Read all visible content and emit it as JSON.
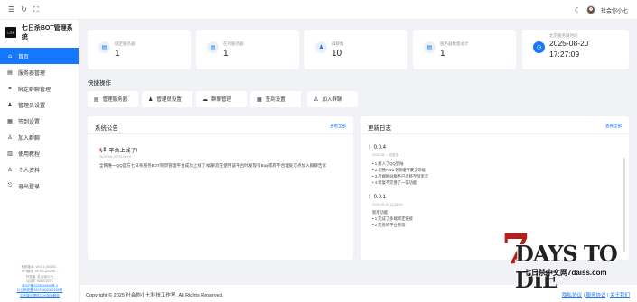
{
  "topbar": {
    "username": "社会你小七"
  },
  "brand": {
    "logo_text": "七日杀",
    "title": "七日杀BOT管理系统"
  },
  "menu": [
    {
      "label": "首页",
      "icon": "home-icon",
      "glyph": "⌂"
    },
    {
      "label": "服务器管理",
      "icon": "server-icon",
      "glyph": "▤"
    },
    {
      "label": "绑定群聊管理",
      "icon": "link-icon",
      "glyph": "⚭"
    },
    {
      "label": "管理员设置",
      "icon": "admin-icon",
      "glyph": "♟"
    },
    {
      "label": "签到设置",
      "icon": "calendar-icon",
      "glyph": "▦"
    },
    {
      "label": "加入群聊",
      "icon": "join-icon",
      "glyph": "♙"
    },
    {
      "label": "使用教程",
      "icon": "book-icon",
      "glyph": "▥"
    },
    {
      "label": "个人资料",
      "icon": "user-icon",
      "glyph": "♙"
    },
    {
      "label": "退出登录",
      "icon": "logout-icon",
      "glyph": "⎋"
    }
  ],
  "sidebar_footer": {
    "line1": "系统版本: v0.0.1 (20250...",
    "line2": "API版本: v0.0.4 (20250...",
    "line3": "开发者: 社会你小七",
    "line4": "QQ群: 925072073",
    "link1": "粤ICP备2025034906号-4",
    "link2": "川公网安备 51070402000159号",
    "link3": "由天翼云提供CDN加速服务"
  },
  "stats": [
    {
      "label": "绑定服务器",
      "value": "1",
      "icon": "server-icon",
      "glyph": "▤"
    },
    {
      "label": "在线服务器",
      "value": "1",
      "icon": "online-server-icon",
      "glyph": "▤"
    },
    {
      "label": "群聊数",
      "value": "10",
      "icon": "group-icon",
      "glyph": "♟"
    },
    {
      "label": "服务器数量总计",
      "value": "1",
      "icon": "server-total-icon",
      "glyph": "▤"
    }
  ],
  "time_card": {
    "label": "北京服务器时间",
    "date": "2025-08-20",
    "time": "17:27:09"
  },
  "quick": {
    "title": "快捷操作",
    "buttons": [
      {
        "label": "管理服务器",
        "glyph": "▤",
        "icon": "server-icon"
      },
      {
        "label": "管理员设置",
        "glyph": "♟",
        "icon": "admin-icon"
      },
      {
        "label": "群聊管理",
        "glyph": "☁",
        "icon": "chat-icon"
      },
      {
        "label": "签到设置",
        "glyph": "▦",
        "icon": "calendar-icon"
      },
      {
        "label": "加入群聊",
        "glyph": "♙",
        "icon": "join-icon"
      }
    ]
  },
  "announcement": {
    "title": "系统公告",
    "more": "查看全部",
    "item_title": "平台上线了!",
    "item_date": "2025-06-10 00:00:00",
    "body": "全网唯一QQ官方七日杀服务BOT网页管理平台成功上线了!如果您在使用该平台时发现有Bug或有不合理处可点加入群聊告诉"
  },
  "changelog": {
    "title": "更新日志",
    "more": "查看全部",
    "entries": [
      {
        "version": "0.0.4",
        "date": "2025-08-... 修复版",
        "items": [
          "1.接入了QQ登陆",
          "2.切换AWS令牌缓存安全等级",
          "3.后端网站服务已迁移至阿里云",
          "4.修复不完善了一等功能"
        ]
      },
      {
        "version": "0.0.1",
        "date": "2025-06-10 12:48:00",
        "sub": "新增功能",
        "items": [
          "1.完成了多端绑定链接",
          "2.完善的平台管理"
        ]
      }
    ]
  },
  "footer": {
    "copyright": "Copyright © 2025 社会你小七科技工作室. All Rights Reserved.",
    "privacy": "隐私协议",
    "service": "服务协议",
    "about": "关于我们"
  },
  "watermark": {
    "seven": "7",
    "big": "DAYS TO DIE",
    "sub": "七日杀中文网7daiss.com"
  }
}
